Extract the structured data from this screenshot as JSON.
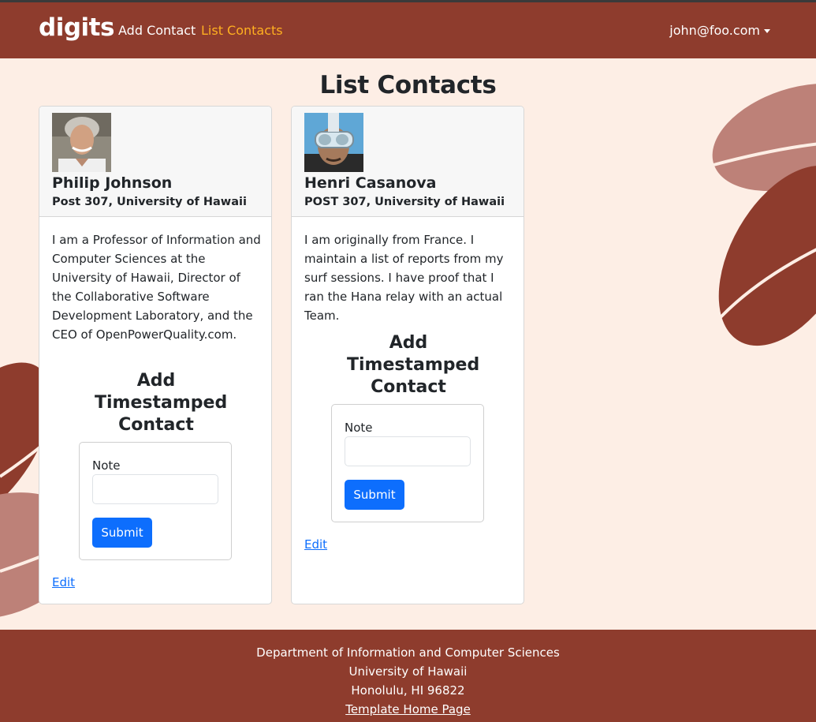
{
  "navbar": {
    "brand": "digits",
    "links": [
      {
        "label": "Add Contact",
        "active": false
      },
      {
        "label": "List Contacts",
        "active": true
      }
    ],
    "user": "john@foo.com"
  },
  "page": {
    "title": "List Contacts"
  },
  "contacts": [
    {
      "name": "Philip Johnson",
      "address": "Post 307, University of Hawaii",
      "description": "I am a Professor of Information and Computer Sciences at the University of Hawaii, Director of the Collaborative Software Development Laboratory, and the CEO of OpenPowerQuality.com.",
      "timestamp_title": "Add Timestamped Contact",
      "note_label": "Note",
      "note_value": "",
      "submit_label": "Submit",
      "edit_label": "Edit"
    },
    {
      "name": "Henri Casanova",
      "address": "POST 307, University of Hawaii",
      "description": "I am originally from France. I maintain a list of reports from my surf sessions. I have proof that I ran the Hana relay with an actual Team.",
      "timestamp_title": "Add Timestamped Contact",
      "note_label": "Note",
      "note_value": "",
      "submit_label": "Submit",
      "edit_label": "Edit"
    }
  ],
  "footer": {
    "line1": "Department of Information and Computer Sciences",
    "line2": "University of Hawaii",
    "line3": "Honolulu, HI 96822",
    "link": "Template Home Page"
  },
  "colors": {
    "navbar": "#8e3c2d",
    "background": "#fdeee5",
    "active_link": "#ffb020",
    "primary_button": "#0d6efd"
  }
}
